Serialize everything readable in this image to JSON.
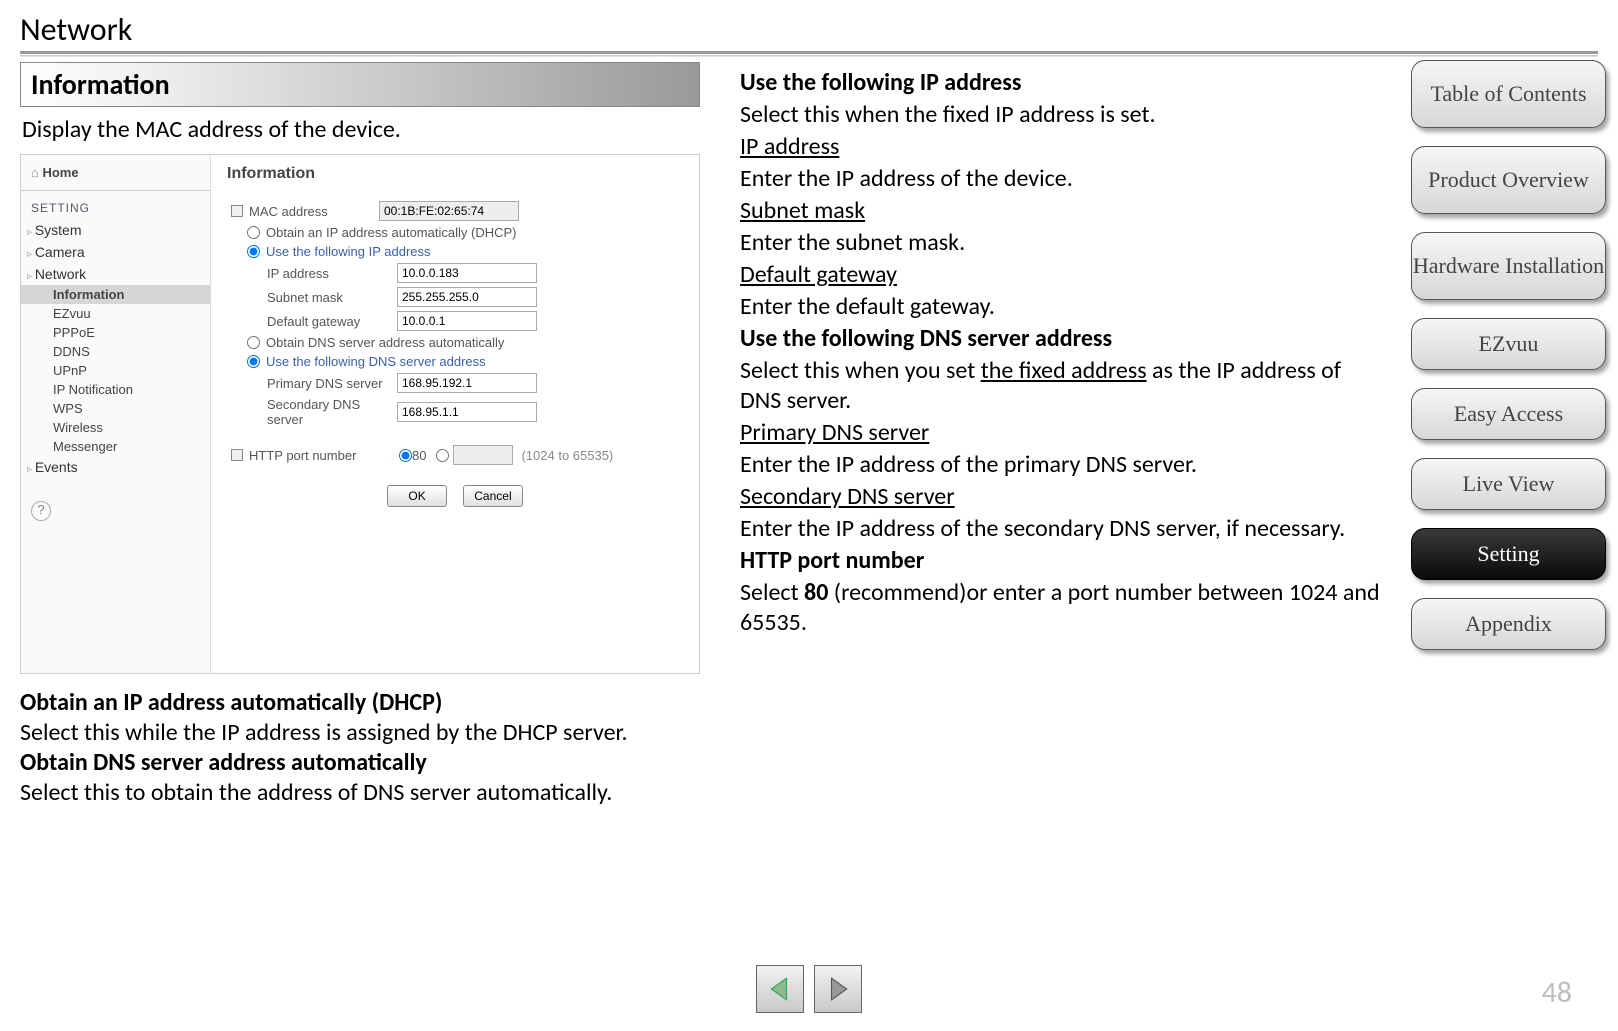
{
  "page_title": "Network",
  "info_header": "Information",
  "info_desc": "Display the MAC address of the device.",
  "screenshot": {
    "home": "Home",
    "setting_header": "SETTING",
    "top_items": [
      "System",
      "Camera",
      "Network"
    ],
    "sub_items": [
      "Information",
      "EZvuu",
      "PPPoE",
      "DDNS",
      "UPnP",
      "IP Notification",
      "WPS",
      "Wireless",
      "Messenger"
    ],
    "active_sub": "Information",
    "events_item": "Events",
    "panel_title": "Information",
    "mac_label": "MAC address",
    "mac_value": "00:1B:FE:02:65:74",
    "dhcp_opt": "Obtain an IP address automatically (DHCP)",
    "static_opt": "Use the following IP address",
    "ip_label": "IP address",
    "ip_value": "10.0.0.183",
    "subnet_label": "Subnet mask",
    "subnet_value": "255.255.255.0",
    "gateway_label": "Default gateway",
    "gateway_value": "10.0.0.1",
    "dns_auto_opt": "Obtain DNS server address automatically",
    "dns_static_opt": "Use the following DNS server address",
    "pdns_label": "Primary DNS server",
    "pdns_value": "168.95.192.1",
    "sdns_label": "Secondary DNS server",
    "sdns_value": "168.95.1.1",
    "http_label": "HTTP port number",
    "http_80": "80",
    "http_range": "(1024 to 65535)",
    "ok": "OK",
    "cancel": "Cancel"
  },
  "left_text": {
    "h1": "Obtain an IP address automatically (DHCP)",
    "p1": "Select this while the IP address is assigned by the DHCP server.",
    "h2": "Obtain DNS server address automatically",
    "p2": "Select this to obtain the address of DNS server automatically."
  },
  "right_text": {
    "h1": "Use the following IP address",
    "p1": "Select this when the fixed IP address is set.",
    "u_ip": "IP address",
    "p_ip": "Enter the IP address of the device.",
    "u_sub": "Subnet mask",
    "p_sub": "Enter the subnet mask.",
    "u_gw": "Default gateway",
    "p_gw": "Enter the default gateway.",
    "h2": "Use the following DNS server address",
    "p2a": "Select this when you set ",
    "p2u": "the fixed address",
    "p2b": " as the IP address of DNS server.",
    "u_pdns": "Primary DNS server",
    "p_pdns": "Enter the IP address of the primary DNS server.",
    "u_sdns": "Secondary DNS server",
    "p_sdns": "Enter the IP address of the secondary DNS server, if necessary.",
    "h3": "HTTP port number",
    "p3a": "Select ",
    "p3b": "80",
    "p3c": " (recommend)or enter a port number between 1024 and 65535."
  },
  "side_nav": [
    "Table of Contents",
    "Product Overview",
    "Hardware Installation",
    "EZvuu",
    "Easy Access",
    "Live View",
    "Setting",
    "Appendix"
  ],
  "active_nav": "Setting",
  "page_number": "48"
}
